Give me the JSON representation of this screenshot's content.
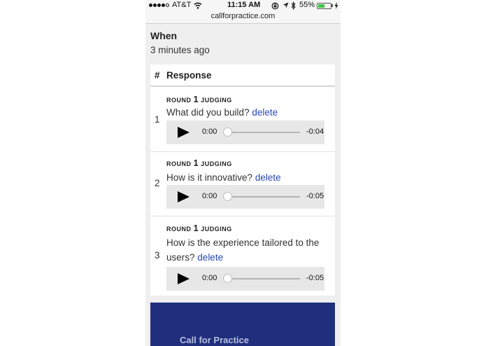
{
  "status_bar": {
    "carrier": "AT&T",
    "time": "11:15 AM",
    "battery_percent": "55%",
    "battery_level": 0.55,
    "signal_bars_filled": 4,
    "signal_bars_total": 5
  },
  "url_bar": {
    "domain": "callforpractice.com"
  },
  "when": {
    "label": "When",
    "value": "3 minutes ago"
  },
  "table": {
    "headers": {
      "number": "#",
      "response": "Response"
    },
    "rows": [
      {
        "number": "1",
        "round_prefix": "ROUND",
        "round_number": "1",
        "round_suffix": "JUDGING",
        "question": "What did you build?",
        "delete_label": "delete",
        "player": {
          "current_time": "0:00",
          "remaining_time": "-0:04"
        }
      },
      {
        "number": "2",
        "round_prefix": "ROUND",
        "round_number": "1",
        "round_suffix": "JUDGING",
        "question": "How is it innovative?",
        "delete_label": "delete",
        "player": {
          "current_time": "0:00",
          "remaining_time": "-0:05"
        }
      },
      {
        "number": "3",
        "round_prefix": "ROUND",
        "round_number": "1",
        "round_suffix": "JUDGING",
        "question": "How is the experience tailored to the users?",
        "delete_label": "delete",
        "player": {
          "current_time": "0:00",
          "remaining_time": "-0:05"
        }
      }
    ]
  },
  "footer": {
    "title": "Call for Practice"
  },
  "colors": {
    "link": "#2747b8",
    "footer_bg": "#1f2e7d",
    "battery": "#3ec444"
  }
}
